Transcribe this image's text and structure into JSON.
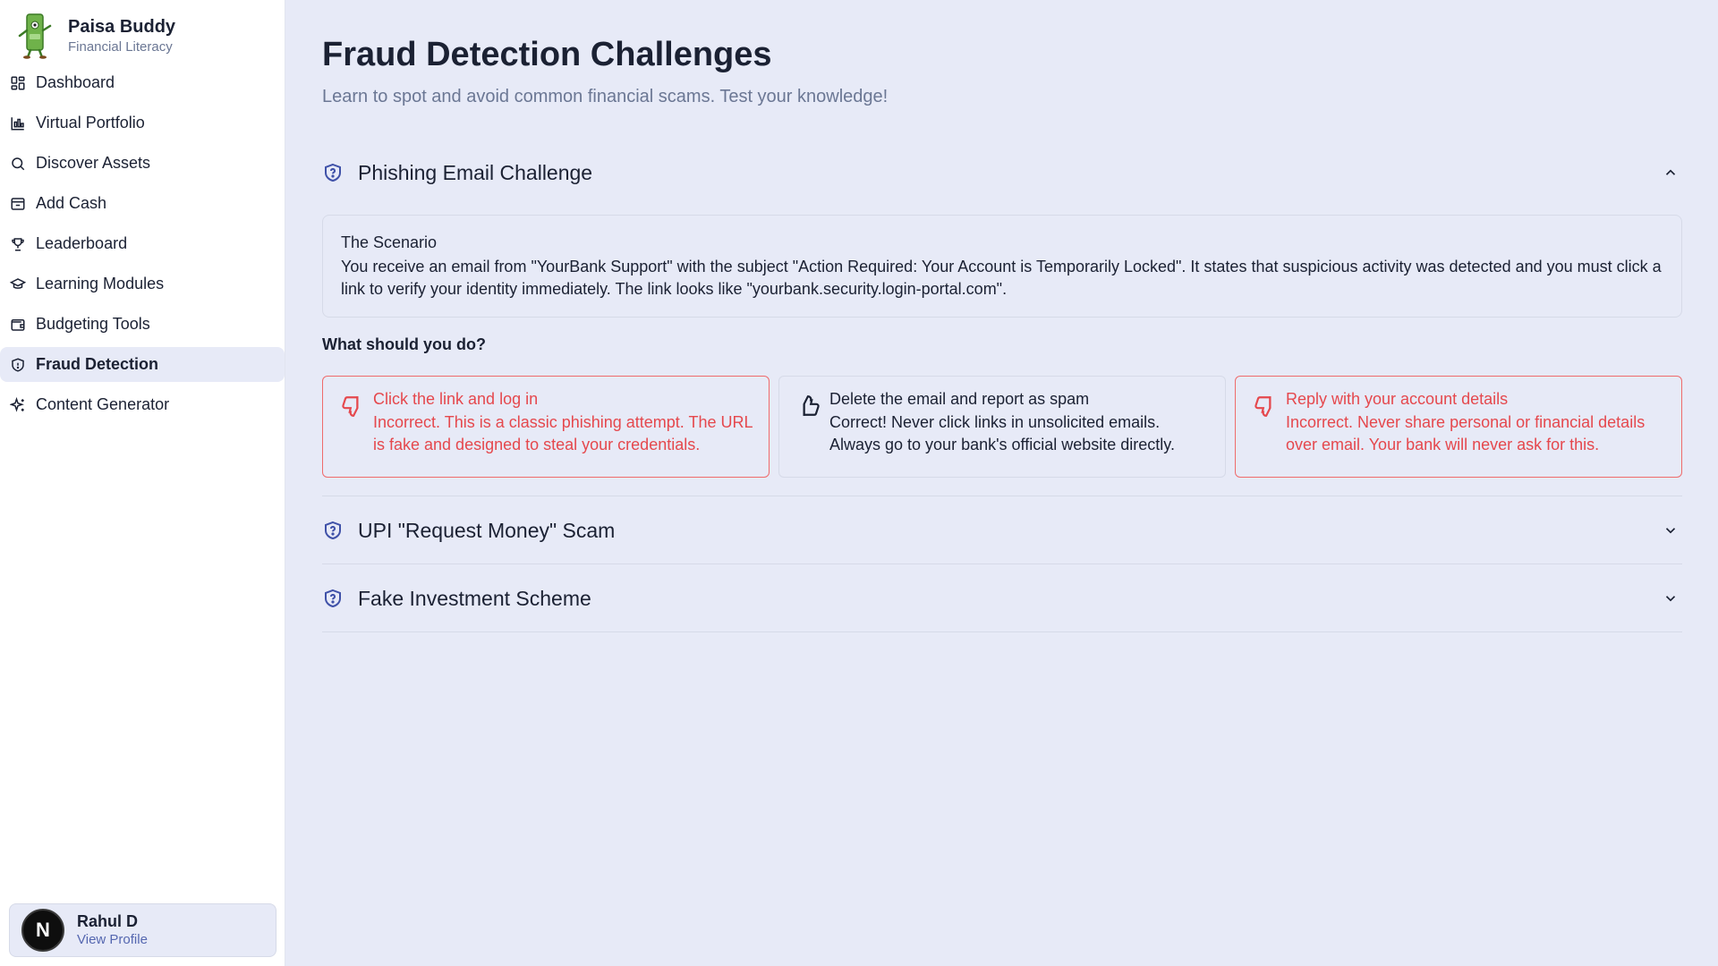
{
  "brand": {
    "name": "Paisa Buddy",
    "subtitle": "Financial Literacy"
  },
  "nav": [
    {
      "label": "Dashboard",
      "icon": "grid-icon"
    },
    {
      "label": "Virtual Portfolio",
      "icon": "chart-icon"
    },
    {
      "label": "Discover Assets",
      "icon": "search-icon"
    },
    {
      "label": "Add Cash",
      "icon": "archive-icon"
    },
    {
      "label": "Leaderboard",
      "icon": "trophy-icon"
    },
    {
      "label": "Learning Modules",
      "icon": "graduation-cap-icon"
    },
    {
      "label": "Budgeting Tools",
      "icon": "wallet-icon"
    },
    {
      "label": "Fraud Detection",
      "icon": "shield-icon",
      "active": true
    },
    {
      "label": "Content Generator",
      "icon": "sparkles-icon"
    }
  ],
  "profile": {
    "name": "Rahul D",
    "link": "View Profile",
    "initial": "N"
  },
  "page": {
    "title": "Fraud Detection Challenges",
    "subtitle": "Learn to spot and avoid common financial scams. Test your knowledge!"
  },
  "challenges": [
    {
      "title": "Phishing Email Challenge",
      "expanded": true,
      "scenario_title": "The Scenario",
      "scenario_text": "You receive an email from \"YourBank Support\" with the subject \"Action Required: Your Account is Temporarily Locked\". It states that suspicious activity was detected and you must click a link to verify your identity immediately. The link looks like \"yourbank.security.login-portal.com\".",
      "question": "What should you do?",
      "options": [
        {
          "label": "Click the link and log in",
          "feedback": "Incorrect. This is a classic phishing attempt. The URL is fake and designed to steal your credentials.",
          "correct": false,
          "icon": "thumbs-down-icon"
        },
        {
          "label": "Delete the email and report as spam",
          "feedback": "Correct! Never click links in unsolicited emails. Always go to your bank's official website directly.",
          "correct": true,
          "icon": "thumbs-up-icon"
        },
        {
          "label": "Reply with your account details",
          "feedback": "Incorrect. Never share personal or financial details over email. Your bank will never ask for this.",
          "correct": false,
          "icon": "thumbs-down-icon"
        }
      ]
    },
    {
      "title": "UPI \"Request Money\" Scam",
      "expanded": false
    },
    {
      "title": "Fake Investment Scheme",
      "expanded": false
    }
  ],
  "colors": {
    "background": "#e7eaf7",
    "error": "#e5484d",
    "accent": "#3f51a8"
  }
}
